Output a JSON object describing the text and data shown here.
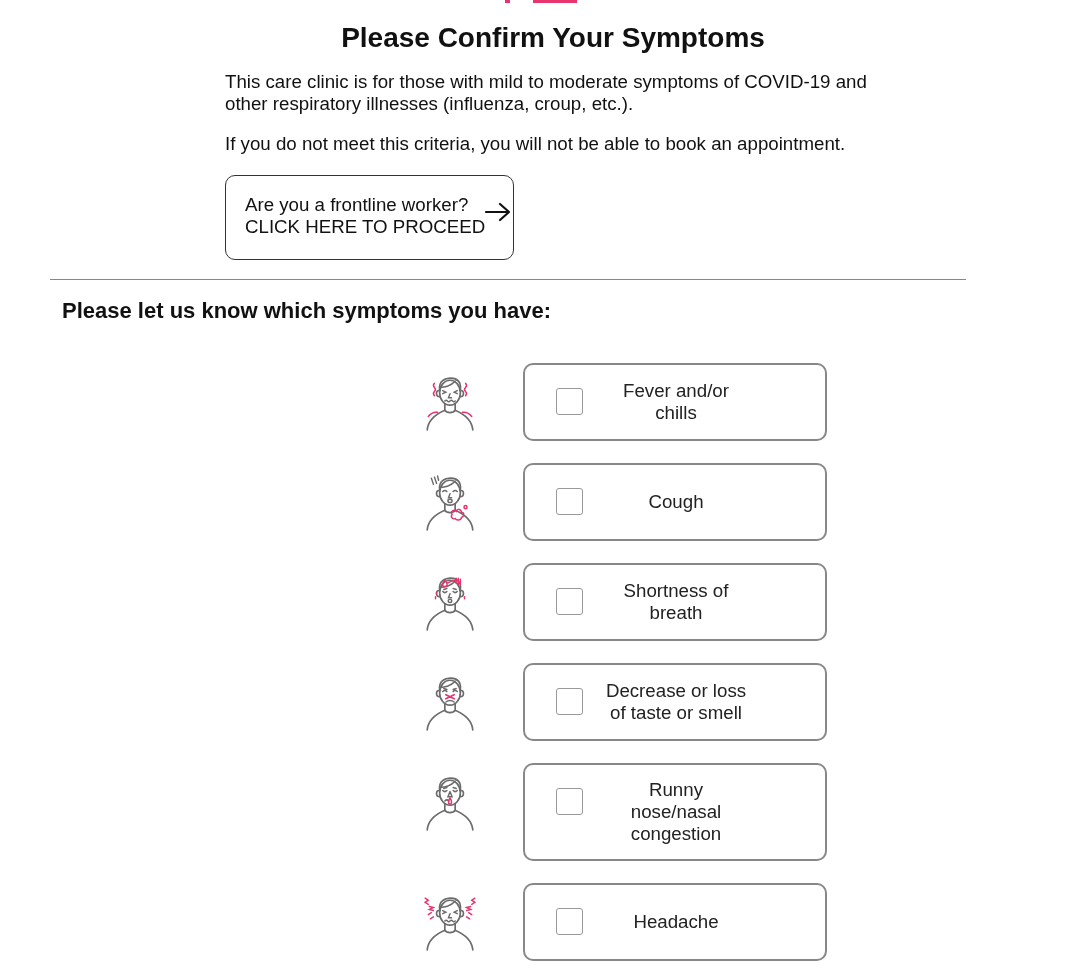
{
  "title": "Please Confirm Your Symptoms",
  "intro": [
    "This care clinic is for those with mild to moderate symptoms of COVID-19 and other respiratory illnesses (influenza, croup, etc.).",
    "If you do not meet this criteria, you will not be able to book an appointment."
  ],
  "frontline_button": {
    "prompt": "Are you a frontline worker?",
    "action": "CLICK HERE TO PROCEED"
  },
  "symptoms_heading": "Please let us know which symptoms you have:",
  "symptoms": [
    {
      "label": "Fever and/or chills",
      "kind": "fever",
      "checked": false
    },
    {
      "label": "Cough",
      "kind": "cough",
      "checked": false
    },
    {
      "label": "Shortness of breath",
      "kind": "breathless",
      "checked": false
    },
    {
      "label": "Decrease or loss of taste or smell",
      "kind": "tasteless",
      "checked": false
    },
    {
      "label": "Runny nose/nasal congestion",
      "kind": "runny",
      "checked": false
    },
    {
      "label": "Headache",
      "kind": "headache",
      "checked": false
    }
  ]
}
